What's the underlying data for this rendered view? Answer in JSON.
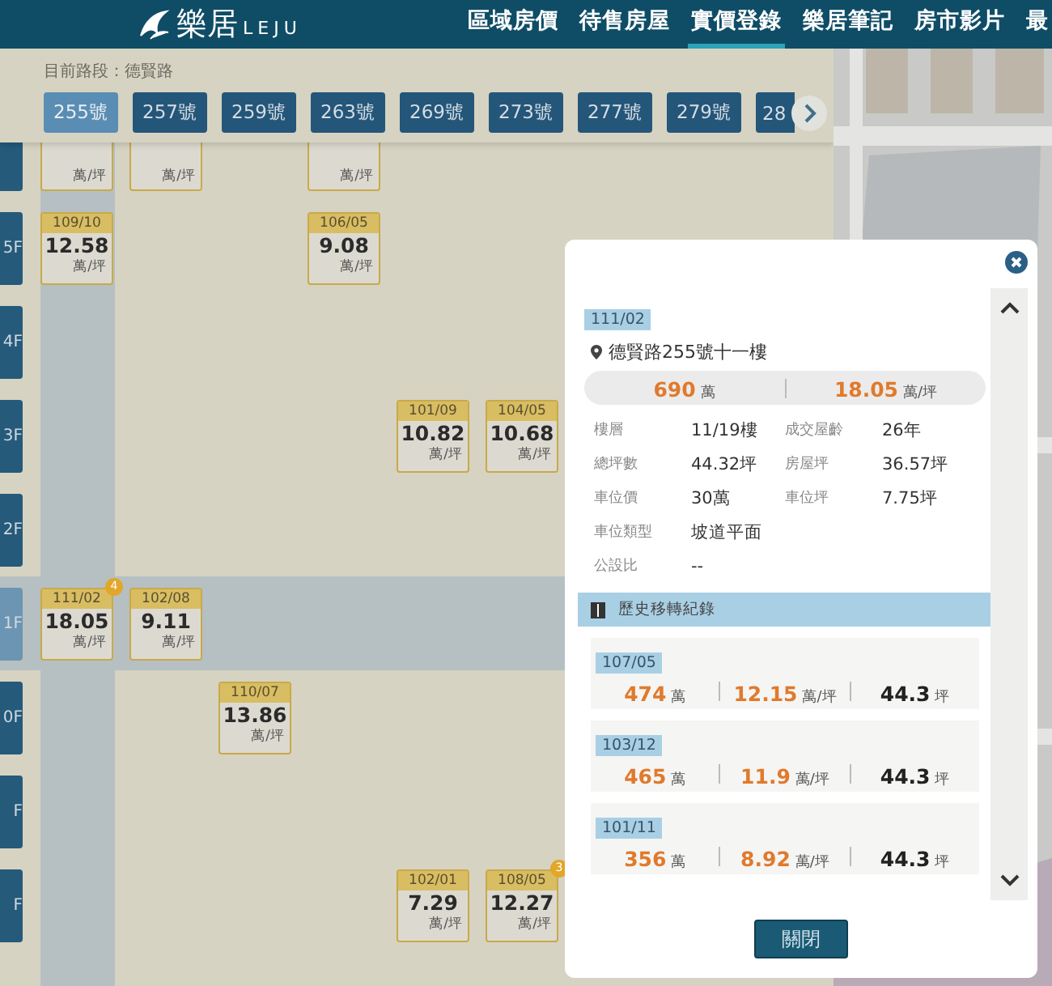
{
  "header": {
    "logo": {
      "brand": "樂居",
      "latin": "LEJU"
    },
    "nav": [
      {
        "label": "區域房價",
        "selected": false
      },
      {
        "label": "待售房屋",
        "selected": false
      },
      {
        "label": "實價登錄",
        "selected": true
      },
      {
        "label": "樂居筆記",
        "selected": false
      },
      {
        "label": "房市影片",
        "selected": false
      },
      {
        "label": "最",
        "selected": false
      }
    ]
  },
  "road": "目前路段：德賢路",
  "addresses": [
    {
      "label": "255號",
      "selected": true
    },
    {
      "label": "257號",
      "selected": false
    },
    {
      "label": "259號",
      "selected": false
    },
    {
      "label": "263號",
      "selected": false
    },
    {
      "label": "269號",
      "selected": false
    },
    {
      "label": "273號",
      "selected": false
    },
    {
      "label": "277號",
      "selected": false
    },
    {
      "label": "279號",
      "selected": false
    },
    {
      "label": "28",
      "selected": false
    }
  ],
  "floors": [
    {
      "selected": false,
      "cells": [
        {
          "unit": "萬/坪"
        },
        {
          "unit": "萬/坪"
        },
        null,
        {
          "unit": "萬/坪"
        },
        null,
        null
      ]
    },
    {
      "label": "5F",
      "selected": false,
      "cells": [
        {
          "date": "109/10",
          "price": "12.58",
          "unit": "萬/坪"
        },
        null,
        null,
        {
          "date": "106/05",
          "price": "9.08",
          "unit": "萬/坪"
        },
        null,
        null
      ]
    },
    {
      "label": "4F",
      "selected": false,
      "cells": [
        null,
        null,
        null,
        null,
        null,
        null
      ]
    },
    {
      "label": "3F",
      "selected": false,
      "cells": [
        null,
        null,
        null,
        null,
        {
          "date": "101/09",
          "price": "10.82",
          "unit": "萬/坪"
        },
        {
          "date": "104/05",
          "price": "10.68",
          "unit": "萬/坪"
        }
      ]
    },
    {
      "label": "2F",
      "selected": false,
      "cells": [
        null,
        null,
        null,
        null,
        null,
        null
      ]
    },
    {
      "label": "1F",
      "selected": true,
      "cells": [
        {
          "date": "111/02",
          "price": "18.05",
          "unit": "萬/坪",
          "badge": "4"
        },
        {
          "date": "102/08",
          "price": "9.11",
          "unit": "萬/坪"
        },
        null,
        null,
        null,
        null
      ]
    },
    {
      "label": "0F",
      "selected": false,
      "cells": [
        null,
        null,
        {
          "date": "110/07",
          "price": "13.86",
          "unit": "萬/坪"
        },
        null,
        null,
        null
      ]
    },
    {
      "label": "F",
      "selected": false,
      "cells": [
        null,
        null,
        null,
        null,
        null,
        null
      ]
    },
    {
      "label": "F",
      "selected": false,
      "cells": [
        null,
        null,
        null,
        null,
        {
          "date": "102/01",
          "price": "7.29",
          "unit": "萬/坪"
        },
        {
          "date": "108/05",
          "price": "12.27",
          "unit": "萬/坪",
          "badge": "3"
        }
      ]
    }
  ],
  "detail": {
    "date": "111/02",
    "address": "德賢路255號十一樓",
    "total": {
      "value": "690",
      "unit": "萬"
    },
    "unit_price": {
      "value": "18.05",
      "unit": "萬/坪"
    },
    "facts": [
      {
        "label": "樓層",
        "value": "11/19樓"
      },
      {
        "label": "成交屋齡",
        "value": "26年"
      },
      {
        "label": "總坪數",
        "value": "44.32坪"
      },
      {
        "label": "房屋坪",
        "value": "36.57坪"
      },
      {
        "label": "車位價",
        "value": "30萬"
      },
      {
        "label": "車位坪",
        "value": "7.75坪"
      },
      {
        "label": "車位類型",
        "value": "坡道平面"
      },
      {
        "label": "公設比",
        "value": "--"
      }
    ],
    "history_title": "歷史移轉紀錄",
    "history": [
      {
        "date": "107/05",
        "total": {
          "value": "474",
          "unit": "萬"
        },
        "unit_price": {
          "value": "12.15",
          "unit": "萬/坪"
        },
        "area": {
          "value": "44.3",
          "unit": "坪"
        }
      },
      {
        "date": "103/12",
        "total": {
          "value": "465",
          "unit": "萬"
        },
        "unit_price": {
          "value": "11.9",
          "unit": "萬/坪"
        },
        "area": {
          "value": "44.3",
          "unit": "坪"
        }
      },
      {
        "date": "101/11",
        "total": {
          "value": "356",
          "unit": "萬"
        },
        "unit_price": {
          "value": "8.92",
          "unit": "萬/坪"
        },
        "area": {
          "value": "44.3",
          "unit": "坪"
        }
      }
    ],
    "close_label": "關閉"
  }
}
